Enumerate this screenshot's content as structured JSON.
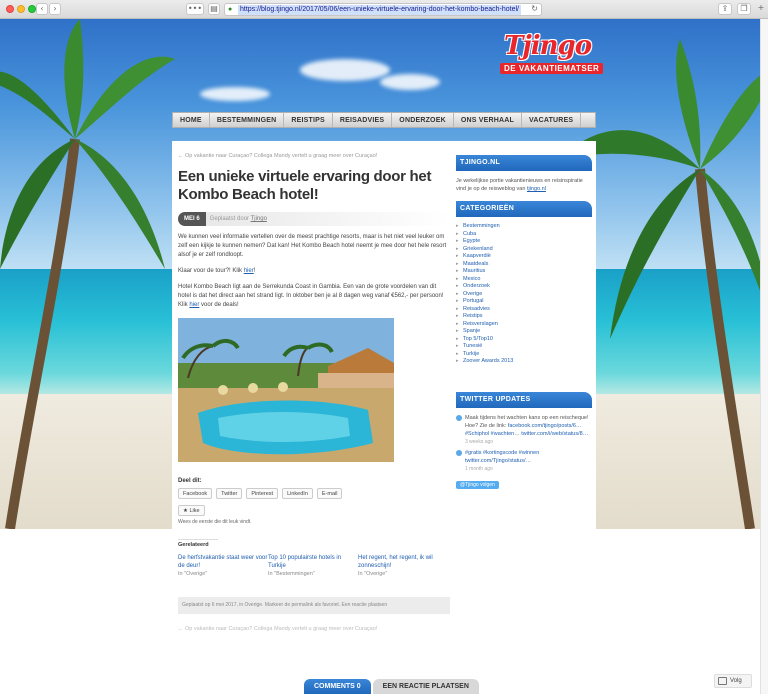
{
  "browser": {
    "url": "https://blog.tjingo.nl/2017/05/06/een-unieke-virtuele-ervaring-door-het-kombo-beach-hotel/",
    "lock_icon": "lock-icon",
    "reload_icon": "reload-icon"
  },
  "logo": {
    "word": "Tjingo",
    "tagline": "DE VAKANTIEMATSER"
  },
  "nav": {
    "items": [
      "HOME",
      "BESTEMMINGEN",
      "REISTIPS",
      "REISADVIES",
      "ONDERZOEK",
      "ONS VERHAAL",
      "VACATURES"
    ]
  },
  "post": {
    "prev_link": "← Op vakantie naar Curaçao? Collega Mandy vertelt u graag meer over Curaçao!",
    "title": "Een unieke virtuele ervaring door het Kombo Beach hotel!",
    "date": "MEI 6",
    "byline_prefix": "Geplaatst door",
    "author": "Tjingo",
    "p1": "We kunnen veel informatie vertellen over de meest prachtige resorts, maar is het niet veel leuker om zelf een kijkje te kunnen nemen? Dat kan! Het Kombo Beach hotel neemt je mee door het hele resort alsof je er zelf rondloopt.",
    "p2_text": "Klaar voor de tour?! Klik ",
    "p2_link": "hier",
    "p2_end": "!",
    "p3_text": "Hotel Kombo Beach ligt aan de Serrekunda Coast in Gambia. Een van de grote voordelen van dit hotel is dat het direct aan het strand ligt. In oktober ben je al 8 dagen weg vanaf €562,- per persoon! Klik ",
    "p3_link": "hier",
    "p3_end": " voor de deals!",
    "share_title": "Deel dit:",
    "share": [
      "Facebook",
      "Twitter",
      "Pinterest",
      "LinkedIn",
      "E-mail"
    ],
    "like_label": "Like",
    "like_note": "Wees de eerste die dit leuk vindt.",
    "related_title": "Gerelateerd",
    "related": [
      {
        "title": "De herfstvakantie staat weer voor de deur!",
        "cat": "In \"Overige\""
      },
      {
        "title": "Top 10 populairste hotels in Turkije",
        "cat": "In \"Bestemmingen\""
      },
      {
        "title": "Het regent, het regent, ik wil zonneschijn!",
        "cat": "In \"Overige\""
      }
    ],
    "footer": "Geplaatst op 6 mei 2017, in Overige. Markeer de permalink als favoriet. Een reactie plaatsen",
    "prev_link2": "← Op vakantie naar Curaçao? Collega Mandy vertelt u graag meer over Curaçao!"
  },
  "sidebar": {
    "tjingo_heading": "TJINGO.NL",
    "tjingo_text": "Je wekelijkse portie vakantienieuws en reisinspiratie vind je op de reisweblog van ",
    "tjingo_link": "tjingo.nl",
    "cat_heading": "CATEGORIEËN",
    "categories": [
      "Bestemmingen",
      "Cuba",
      "Egypte",
      "Griekenland",
      "Kaapverdië",
      "Maatdeals",
      "Mauritius",
      "Mexico",
      "Onderzoek",
      "Overige",
      "Portugal",
      "Reisadvies",
      "Reistips",
      "Reisverslagen",
      "Spanje",
      "Top 5/Top10",
      "Tunesië",
      "Turkije",
      "Zoover Awards 2013"
    ],
    "tw_heading": "TWITTER UPDATES",
    "tweets": [
      {
        "text": "Maak tijdens het wachten kans op een reischeque! Hoe? Zie de link: ",
        "link": "facebook.com/tjingo/posts/6… #Schiphol #wachten… twitter.com/i/web/status/8…",
        "time": "3 weeks ago"
      },
      {
        "text": "",
        "link": "#gratis #kortingscode #winnen twitter.com/Tjingo/status/…",
        "time": "1 month ago"
      }
    ],
    "follow_label": "@Tjingo volgen"
  },
  "comments": {
    "tab_a": "COMMENTS 0",
    "tab_b": "EEN REACTIE PLAATSEN"
  },
  "floating": {
    "follow": "Volg"
  }
}
